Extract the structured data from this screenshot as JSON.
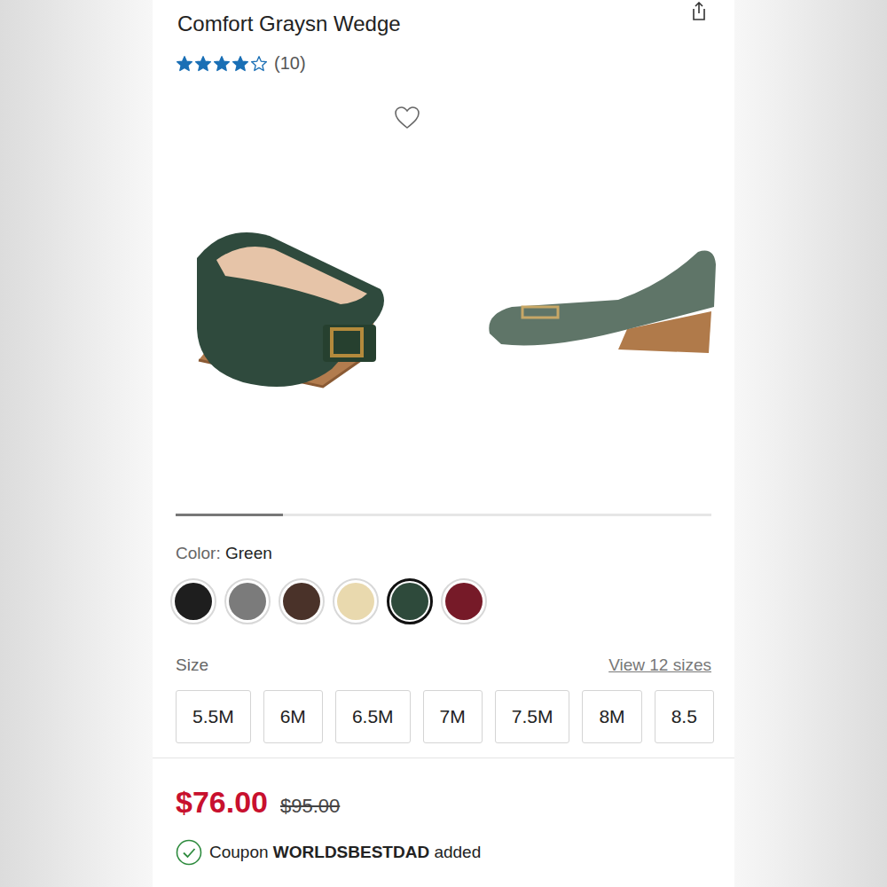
{
  "header": {
    "title": "Comfort Graysn Wedge"
  },
  "rating": {
    "stars": 4,
    "max": 5,
    "count": "(10)"
  },
  "favorite": {
    "selected": false
  },
  "carousel": {
    "level": 0.2
  },
  "color": {
    "label": "Color:",
    "value": "Green",
    "swatches": [
      {
        "color": "#1e1e1e",
        "selected": false
      },
      {
        "color": "#7b7b7b",
        "selected": false
      },
      {
        "color": "#4a3229",
        "selected": false
      },
      {
        "color": "#e9d9ae",
        "selected": false
      },
      {
        "color": "#2e4a3b",
        "selected": true
      },
      {
        "color": "#761a28",
        "selected": false
      }
    ]
  },
  "size": {
    "label": "Size",
    "link": "View 12 sizes",
    "options": [
      {
        "label": "5.5M",
        "selected": false
      },
      {
        "label": "6M",
        "selected": false
      },
      {
        "label": "6.5M",
        "selected": false
      },
      {
        "label": "7M",
        "selected": false
      },
      {
        "label": "7.5M",
        "selected": false
      },
      {
        "label": "8M",
        "selected": false
      },
      {
        "label": "8.5",
        "selected": false
      }
    ]
  },
  "price": {
    "current": "$76.00",
    "original": "$95.00"
  },
  "coupon": {
    "label": "Coupon",
    "code": "WORLDSBESTDAD",
    "status": "added",
    "applied": true
  }
}
